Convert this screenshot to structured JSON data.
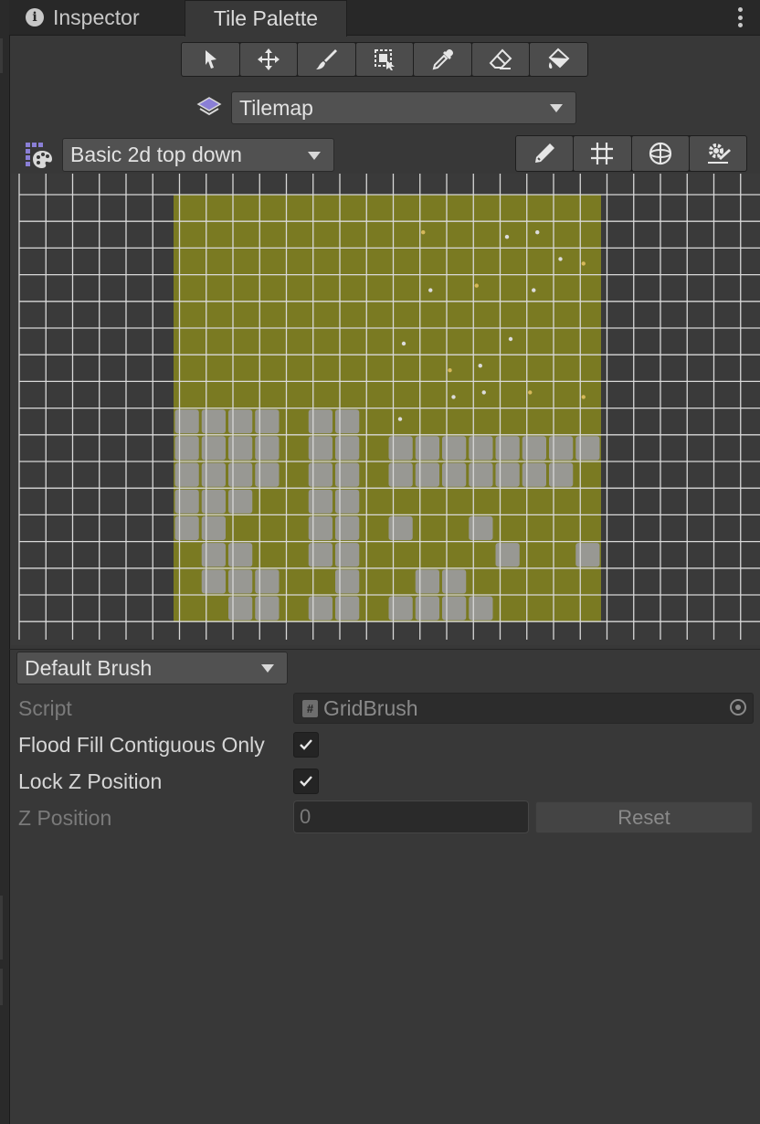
{
  "tabs": [
    {
      "label": "Inspector",
      "icon": "info-icon"
    },
    {
      "label": "Tile Palette",
      "active": true
    }
  ],
  "tools": [
    "select-tool-icon",
    "move-tool-icon",
    "paint-brush-tool-icon",
    "box-fill-tool-icon",
    "picker-tool-icon",
    "erase-tool-icon",
    "flood-fill-tool-icon"
  ],
  "active_tilemap": {
    "icon": "layers-icon",
    "value": "Tilemap"
  },
  "palette": {
    "icon": "palette-icon",
    "value": "Basic 2d top down"
  },
  "view_tools": [
    "edit-pencil-icon",
    "grid-toggle-icon",
    "gizmo-icon",
    "settings-icon"
  ],
  "brush": {
    "dropdown_value": "Default Brush",
    "script_label": "Script",
    "script_value": "GridBrush",
    "flood_fill_label": "Flood Fill Contiguous Only",
    "flood_fill_checked": true,
    "lock_z_label": "Lock Z Position",
    "lock_z_checked": true,
    "z_position_label": "Z Position",
    "z_position_value": "0",
    "reset_label": "Reset"
  },
  "colors": {
    "panel_bg": "#383838",
    "tab_bar_bg": "#282828",
    "palette_fill": "#7a7a22",
    "stone": "#9a9a9a",
    "grid_line": "#d8d8d8"
  }
}
